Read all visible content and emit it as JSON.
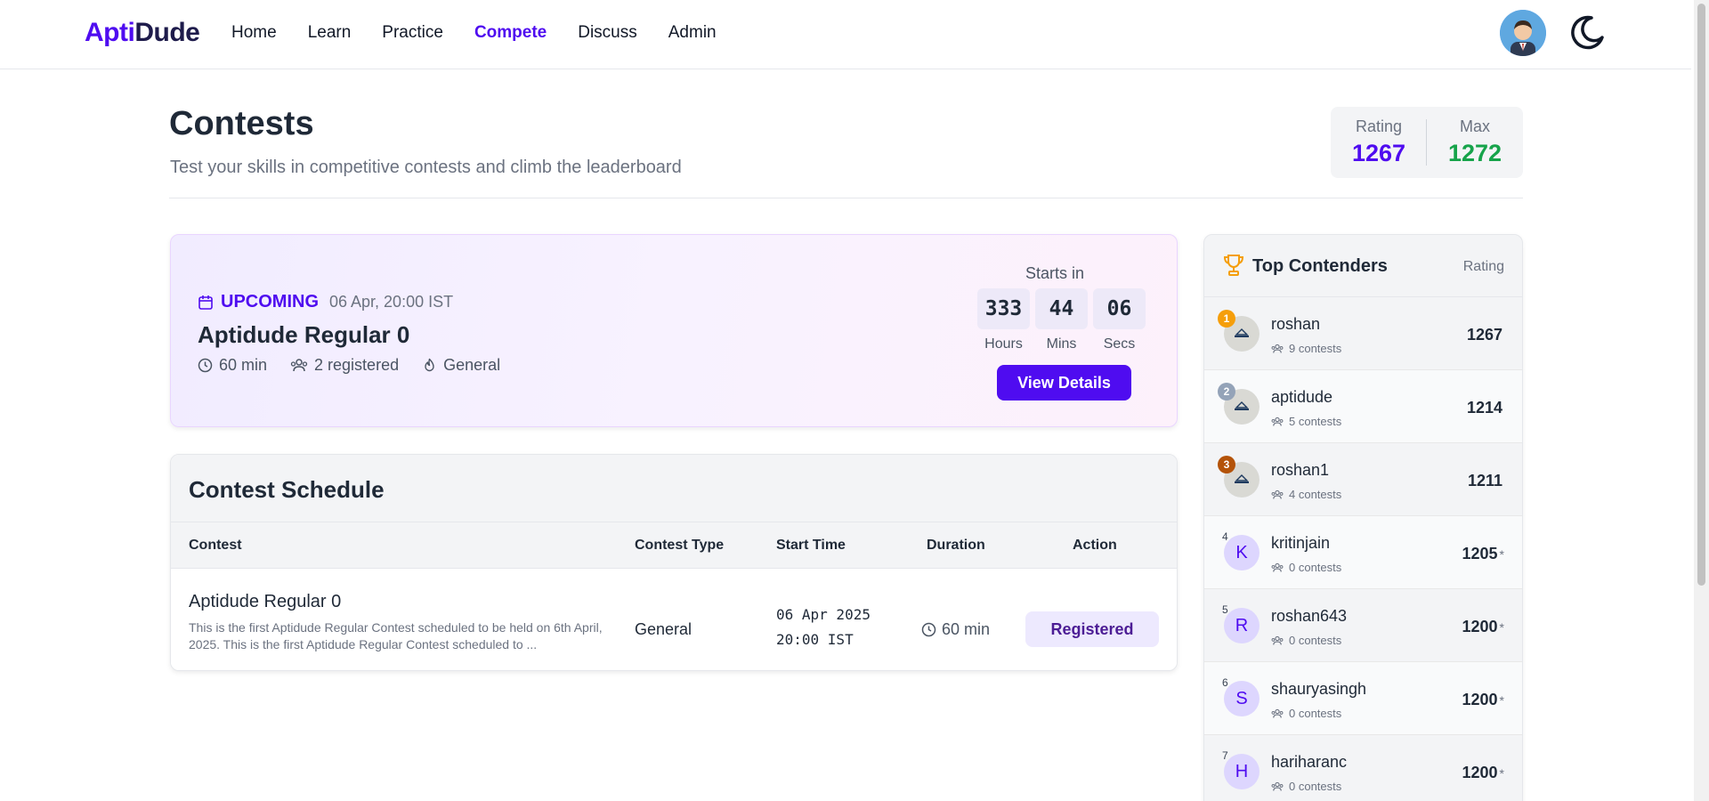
{
  "nav": {
    "logo_part1": "Apti",
    "logo_part2": "Dude",
    "links": [
      "Home",
      "Learn",
      "Practice",
      "Compete",
      "Discuss",
      "Admin"
    ],
    "active_link": "Compete",
    "avatar_icon": "user-avatar-icon",
    "theme_icon": "moon-icon"
  },
  "header": {
    "title": "Contests",
    "subtitle": "Test your skills in competitive contests and climb the leaderboard",
    "rating_label": "Rating",
    "rating_value": "1267",
    "max_label": "Max",
    "max_value": "1272"
  },
  "upcoming": {
    "status": "UPCOMING",
    "date": "06 Apr, 20:00 IST",
    "title": "Aptidude Regular 0",
    "duration": "60 min",
    "registered": "2 registered",
    "type": "General",
    "starts_in_label": "Starts in",
    "hours": "333",
    "mins": "44",
    "secs": "06",
    "hours_label": "Hours",
    "mins_label": "Mins",
    "secs_label": "Secs",
    "button_label": "View Details"
  },
  "schedule": {
    "title": "Contest Schedule",
    "columns": [
      "Contest",
      "Contest Type",
      "Start Time",
      "Duration",
      "Action"
    ],
    "rows": [
      {
        "name": "Aptidude Regular 0",
        "description": "This is the first Aptidude Regular Contest scheduled to be held on 6th April, 2025. This is the first Aptidude Regular Contest scheduled to ...",
        "type": "General",
        "start_date": "06 Apr 2025",
        "start_time": "20:00 IST",
        "duration": "60 min",
        "action": "Registered"
      }
    ]
  },
  "contenders": {
    "title": "Top Contenders",
    "rating_label": "Rating",
    "rows": [
      {
        "rank": "1",
        "name": "roshan",
        "contests": "9 contests",
        "rating": "1267",
        "star": "",
        "avatar": "logo",
        "initial": ""
      },
      {
        "rank": "2",
        "name": "aptidude",
        "contests": "5 contests",
        "rating": "1214",
        "star": "",
        "avatar": "logo",
        "initial": ""
      },
      {
        "rank": "3",
        "name": "roshan1",
        "contests": "4 contests",
        "rating": "1211",
        "star": "",
        "avatar": "logo",
        "initial": ""
      },
      {
        "rank": "4",
        "name": "kritinjain",
        "contests": "0 contests",
        "rating": "1205",
        "star": "*",
        "avatar": "letter",
        "initial": "K"
      },
      {
        "rank": "5",
        "name": "roshan643",
        "contests": "0 contests",
        "rating": "1200",
        "star": "*",
        "avatar": "letter",
        "initial": "R"
      },
      {
        "rank": "6",
        "name": "shauryasingh",
        "contests": "0 contests",
        "rating": "1200",
        "star": "*",
        "avatar": "letter",
        "initial": "S"
      },
      {
        "rank": "7",
        "name": "hariharanc",
        "contests": "0 contests",
        "rating": "1200",
        "star": "*",
        "avatar": "letter",
        "initial": "H"
      }
    ],
    "badge_colors": {
      "1": "#f59e0b",
      "2": "#94a3b8",
      "3": "#b45309"
    }
  },
  "colors": {
    "accent": "#4f0cf0",
    "max_green": "#16a34a"
  }
}
